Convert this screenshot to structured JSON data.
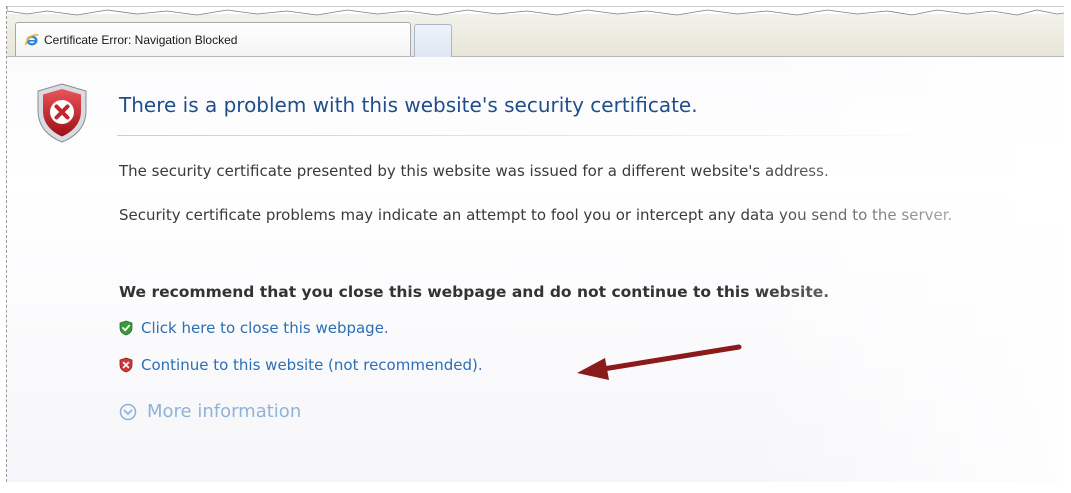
{
  "tab": {
    "title": "Certificate Error: Navigation Blocked"
  },
  "page": {
    "headline": "There is a problem with this website's security certificate.",
    "paragraph_1": "The security certificate presented by this website was issued for a different website's address.",
    "paragraph_2": "Security certificate problems may indicate an attempt to fool you or intercept any data you send to the server.",
    "recommendation": "We recommend that you close this webpage and do not continue to this website.",
    "close_link": "Click here to close this webpage.",
    "continue_link": "Continue to this website (not recommended).",
    "more_info": "More information"
  },
  "icons": {
    "tab": "ie-icon",
    "main": "shield-error-icon",
    "close": "shield-check-icon",
    "continue": "shield-x-icon",
    "more": "chevron-down-circle-icon",
    "annotation": "red-arrow"
  },
  "colors": {
    "headline": "#1f4e8a",
    "link": "#2b6fb7",
    "more_info": "#8fb2d8",
    "shield_red": "#c0272d",
    "shield_green": "#3b9a3b",
    "annotation_arrow": "#8b1a1a"
  }
}
